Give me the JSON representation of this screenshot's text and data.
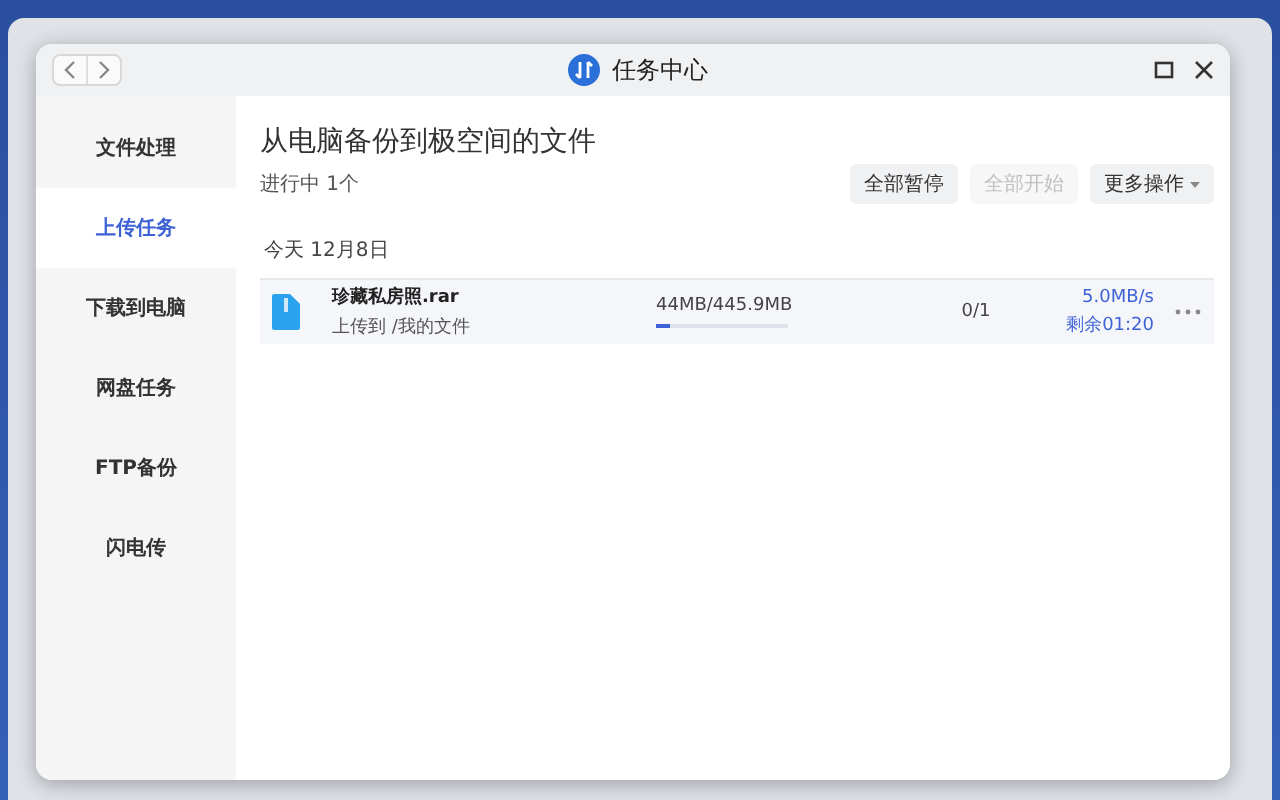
{
  "window": {
    "title": "任务中心"
  },
  "sidebar": {
    "items": [
      {
        "label": "文件处理",
        "selected": false
      },
      {
        "label": "上传任务",
        "selected": true
      },
      {
        "label": "下载到电脑",
        "selected": false
      },
      {
        "label": "网盘任务",
        "selected": false
      },
      {
        "label": "FTP备份",
        "selected": false
      },
      {
        "label": "闪电传",
        "selected": false
      }
    ]
  },
  "header": {
    "title": "从电脑备份到极空间的文件",
    "status": "进行中 1个"
  },
  "buttons": [
    {
      "label": "全部暂停",
      "disabled": false
    },
    {
      "label": "全部开始",
      "disabled": true
    },
    {
      "label": "更多操作",
      "disabled": false
    }
  ],
  "groups": [
    {
      "date": "今天 12月8日",
      "tasks": [
        {
          "name": "珍藏私房照.rar",
          "destination": "上传到 /我的文件",
          "size": "44MB/445.9MB",
          "level": 0.1,
          "count": "0/1",
          "speed": "5.0MB/s",
          "remaining": "剩余01:20"
        }
      ]
    }
  ]
}
